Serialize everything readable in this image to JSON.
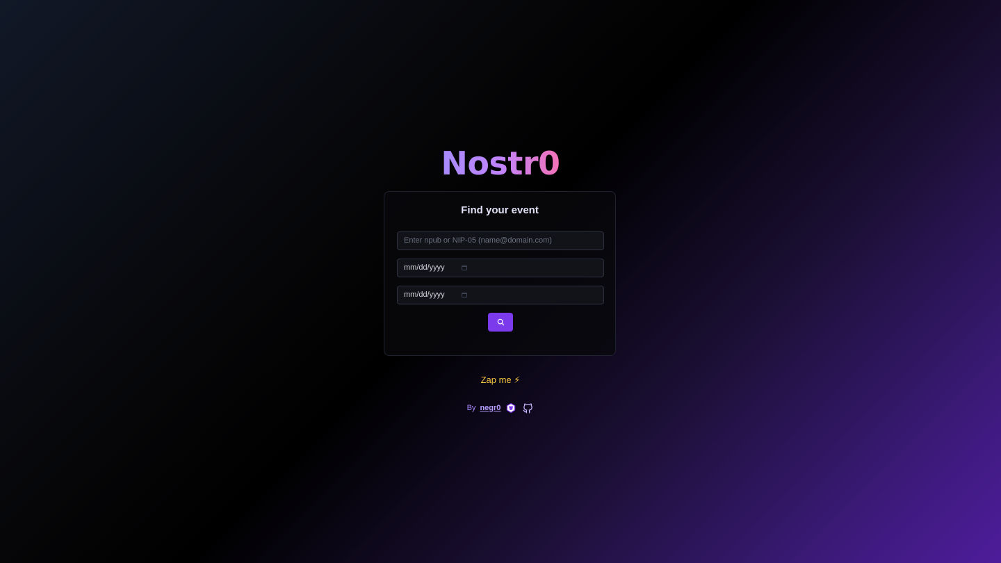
{
  "brand": {
    "logo_text": "Nostr0"
  },
  "search_card": {
    "title": "Find your event",
    "identity_input": {
      "placeholder": "Enter npub or NIP-05 (name@domain.com)",
      "value": ""
    },
    "start_date": {
      "placeholder": "mm/dd/yyyy"
    },
    "end_date": {
      "placeholder": "mm/dd/yyyy"
    },
    "search_button_icon": "search-icon"
  },
  "footer": {
    "zap_label": "Zap me ⚡",
    "by_label": "By",
    "author_link": "negr0",
    "icons": [
      "nostr-icon",
      "github-icon"
    ]
  },
  "colors": {
    "accent": "#7c3aed",
    "logo_start": "#a78bfa",
    "logo_end": "#f472b6",
    "zap": "#f5c542"
  }
}
